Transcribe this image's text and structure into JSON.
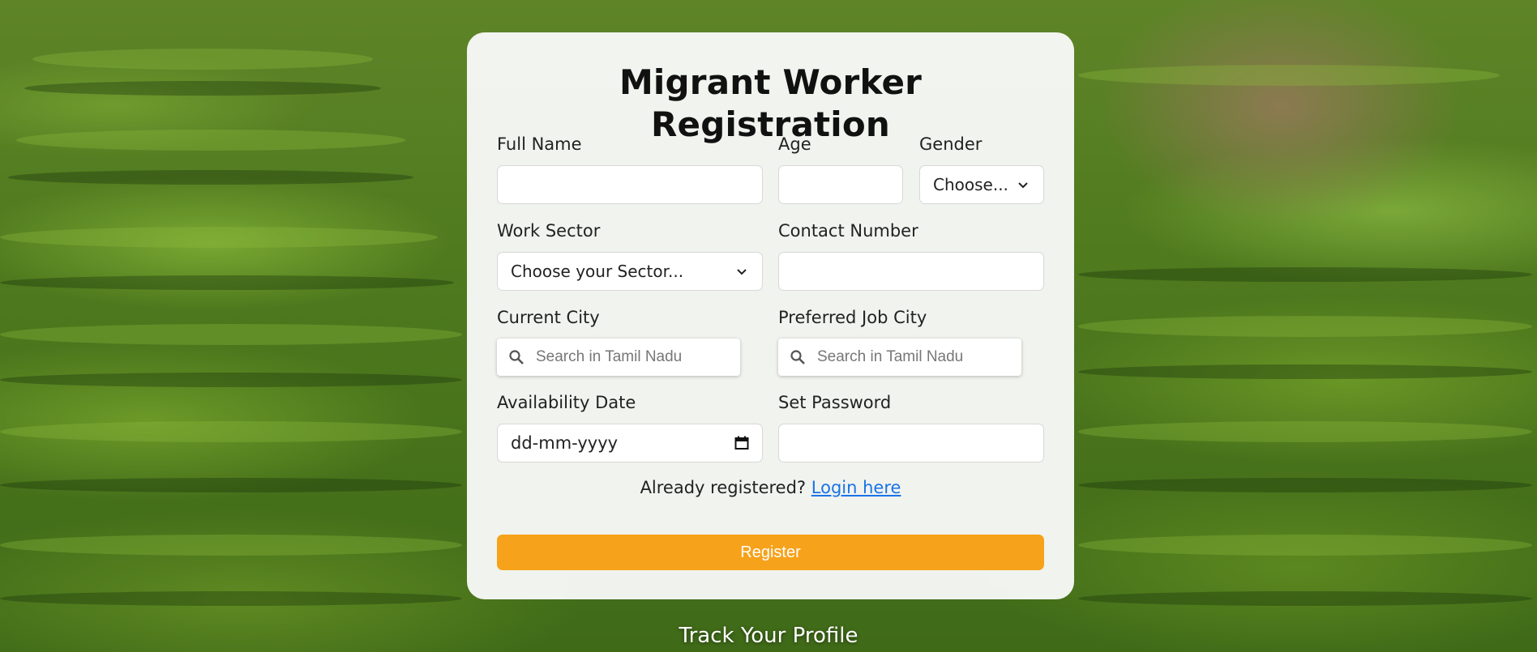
{
  "form": {
    "title": "Migrant Worker Registration",
    "full_name": {
      "label": "Full Name",
      "value": ""
    },
    "age": {
      "label": "Age",
      "value": ""
    },
    "gender": {
      "label": "Gender",
      "selected": "Choose..."
    },
    "work_sector": {
      "label": "Work Sector",
      "selected": "Choose your Sector..."
    },
    "contact_number": {
      "label": "Contact Number",
      "value": ""
    },
    "current_city": {
      "label": "Current City",
      "placeholder": "Search in Tamil Nadu"
    },
    "preferred_city": {
      "label": "Preferred Job City",
      "placeholder": "Search in Tamil Nadu"
    },
    "availability_date": {
      "label": "Availability Date",
      "placeholder": "dd-mm-yyyy"
    },
    "password": {
      "label": "Set Password",
      "value": ""
    },
    "login_prompt": "Already registered?",
    "login_link": "Login here",
    "register_label": "Register"
  },
  "footer": {
    "track_label": "Track Your Profile"
  },
  "colors": {
    "accent": "#f7a21b",
    "link": "#1a73e8",
    "card": "#fafafa"
  },
  "icons": {
    "dropdown": "chevron-down-icon",
    "search": "search-icon",
    "calendar": "calendar-icon"
  }
}
